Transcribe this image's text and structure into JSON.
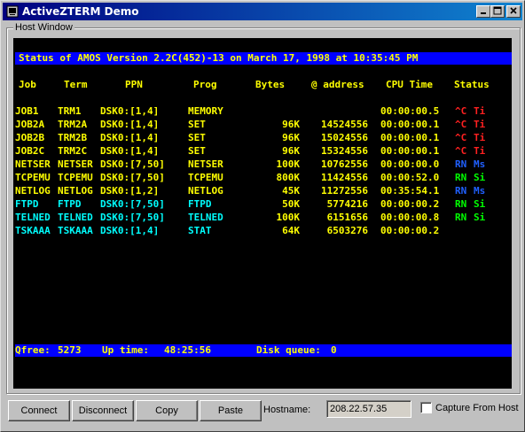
{
  "window": {
    "title": "ActiveZTERM Demo"
  },
  "group": {
    "label": "Host Window"
  },
  "terminal": {
    "header": "Status of AMOS Version 2.2C(452)-13 on March 17, 1998 at 10:35:45 PM",
    "columns": [
      "Job",
      "Term",
      "PPN",
      "Prog",
      "Bytes",
      "@ address",
      "CPU Time",
      "Status"
    ],
    "rows": [
      {
        "job": "JOB1",
        "term": "TRM1",
        "ppn": "DSK0:[1,4]",
        "prog": "MEMORY",
        "bytes": "",
        "addr": "",
        "cpu": "00:00:00.5",
        "s1": "^C",
        "s2": "Ti",
        "color": "y",
        "s1c": "r",
        "s2c": "r"
      },
      {
        "job": "JOB2A",
        "term": "TRM2A",
        "ppn": "DSK0:[1,4]",
        "prog": "SET",
        "bytes": "96K",
        "addr": "14524556",
        "cpu": "00:00:00.1",
        "s1": "^C",
        "s2": "Ti",
        "color": "y",
        "s1c": "r",
        "s2c": "r"
      },
      {
        "job": "JOB2B",
        "term": "TRM2B",
        "ppn": "DSK0:[1,4]",
        "prog": "SET",
        "bytes": "96K",
        "addr": "15024556",
        "cpu": "00:00:00.1",
        "s1": "^C",
        "s2": "Ti",
        "color": "y",
        "s1c": "r",
        "s2c": "r"
      },
      {
        "job": "JOB2C",
        "term": "TRM2C",
        "ppn": "DSK0:[1,4]",
        "prog": "SET",
        "bytes": "96K",
        "addr": "15324556",
        "cpu": "00:00:00.1",
        "s1": "^C",
        "s2": "Ti",
        "color": "y",
        "s1c": "r",
        "s2c": "r"
      },
      {
        "job": "NETSER",
        "term": "NETSER",
        "ppn": "DSK0:[7,50]",
        "prog": "NETSER",
        "bytes": "100K",
        "addr": "10762556",
        "cpu": "00:00:00.0",
        "s1": "RN",
        "s2": "Ms",
        "color": "y",
        "s1c": "b",
        "s2c": "b"
      },
      {
        "job": "TCPEMU",
        "term": "TCPEMU",
        "ppn": "DSK0:[7,50]",
        "prog": "TCPEMU",
        "bytes": "800K",
        "addr": "11424556",
        "cpu": "00:00:52.0",
        "s1": "RN",
        "s2": "Si",
        "color": "y",
        "s1c": "g",
        "s2c": "g"
      },
      {
        "job": "NETLOG",
        "term": "NETLOG",
        "ppn": "DSK0:[1,2]",
        "prog": "NETLOG",
        "bytes": "45K",
        "addr": "11272556",
        "cpu": "00:35:54.1",
        "s1": "RN",
        "s2": "Ms",
        "color": "y",
        "s1c": "b",
        "s2c": "b"
      },
      {
        "job": "FTPD",
        "term": "FTPD",
        "ppn": "DSK0:[7,50]",
        "prog": "FTPD",
        "bytes": "50K",
        "addr": "5774216",
        "cpu": "00:00:00.2",
        "s1": "RN",
        "s2": "Si",
        "color": "c",
        "s1c": "g",
        "s2c": "g"
      },
      {
        "job": "TELNED",
        "term": "TELNED",
        "ppn": "DSK0:[7,50]",
        "prog": "TELNED",
        "bytes": "100K",
        "addr": "6151656",
        "cpu": "00:00:00.8",
        "s1": "RN",
        "s2": "Si",
        "color": "c",
        "s1c": "g",
        "s2c": "g"
      },
      {
        "job": "TSKAAA",
        "term": "TSKAAA",
        "ppn": "DSK0:[1,4]",
        "prog": "STAT",
        "bytes": "64K",
        "addr": "6503276",
        "cpu": "00:00:00.2",
        "s1": "",
        "s2": "",
        "color": "c",
        "s1c": "g",
        "s2c": "g"
      }
    ],
    "footer": {
      "qfree_label": "Qfree:",
      "qfree": "5273",
      "uptime_label": "Up time:",
      "uptime": "48:25:56",
      "diskq_label": "Disk queue:",
      "diskq": "0"
    }
  },
  "toolbar": {
    "connect": "Connect",
    "disconnect": "Disconnect",
    "copy": "Copy",
    "paste": "Paste",
    "hostname_label": "Hostname:",
    "hostname": "208.22.57.35",
    "capture_label": "Capture From Host"
  },
  "colors": {
    "terminal_bg": "#000000",
    "header_bar": "#0000ff",
    "yellow": "#ffff00",
    "cyan": "#00ffff",
    "red": "#ff2020",
    "green": "#00ff00",
    "blue": "#2060ff"
  }
}
